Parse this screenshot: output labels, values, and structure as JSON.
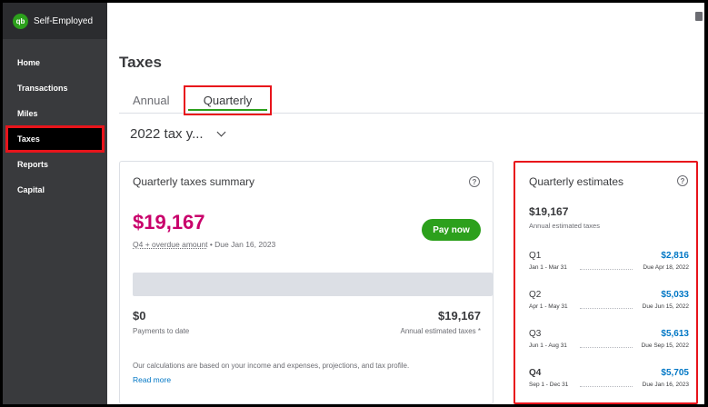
{
  "sidebar": {
    "brand": "Self-Employed",
    "logo_text": "qb",
    "items": [
      {
        "label": "Home",
        "active": false
      },
      {
        "label": "Transactions",
        "active": false
      },
      {
        "label": "Miles",
        "active": false
      },
      {
        "label": "Taxes",
        "active": true
      },
      {
        "label": "Reports",
        "active": false
      },
      {
        "label": "Capital",
        "active": false
      }
    ]
  },
  "page": {
    "title": "Taxes",
    "tabs": [
      {
        "label": "Annual",
        "selected": false
      },
      {
        "label": "Quarterly",
        "selected": true
      }
    ],
    "year_selector": "2022 tax y..."
  },
  "summary": {
    "title": "Quarterly taxes summary",
    "amount": "$19,167",
    "overdue_link": "Q4 + overdue amount",
    "due_text": " • Due Jan 16, 2023",
    "pay_button": "Pay now",
    "progress_fraction": 0,
    "paid_value": "$0",
    "paid_label": "Payments to date",
    "annual_value": "$19,167",
    "annual_label": "Annual estimated taxes *",
    "note": "Our calculations are based on your income and expenses, projections, and tax profile.",
    "read_more": "Read more"
  },
  "estimates": {
    "title": "Quarterly estimates",
    "total": "$19,167",
    "total_label": "Annual estimated taxes",
    "quarters": [
      {
        "name": "Q1",
        "amount": "$2,816",
        "range": "Jan 1 - Mar 31",
        "due": "Due Apr 18, 2022",
        "bold": false
      },
      {
        "name": "Q2",
        "amount": "$5,033",
        "range": "Apr 1 - May 31",
        "due": "Due Jun 15, 2022",
        "bold": false
      },
      {
        "name": "Q3",
        "amount": "$5,613",
        "range": "Jun 1 - Aug 31",
        "due": "Due Sep 15, 2022",
        "bold": false
      },
      {
        "name": "Q4",
        "amount": "$5,705",
        "range": "Sep 1 - Dec 31",
        "due": "Due Jan 16, 2023",
        "bold": true
      }
    ]
  },
  "colors": {
    "accent_green": "#2ca01c",
    "amount_magenta": "#c9006b",
    "link_blue": "#0077c5",
    "highlight_red": "#e8141b",
    "sidebar_bg": "#393a3d"
  },
  "icons": {
    "help": "help-circle-icon",
    "chevron": "chevron-down-icon"
  }
}
